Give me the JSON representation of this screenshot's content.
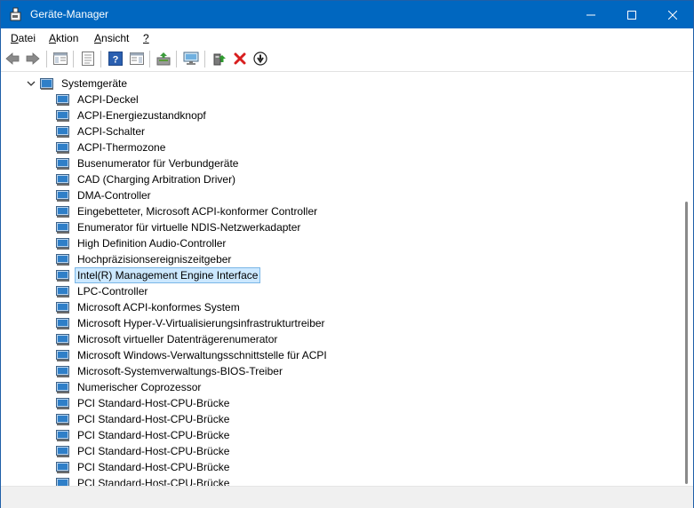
{
  "window": {
    "title": "Geräte-Manager"
  },
  "menu": {
    "items": [
      {
        "acc": "D",
        "rest": "atei"
      },
      {
        "acc": "A",
        "rest": "ktion"
      },
      {
        "acc": "A",
        "rest": "nsicht"
      },
      {
        "acc": "?",
        "rest": ""
      }
    ]
  },
  "toolbar": {
    "icons": [
      "back-icon",
      "forward-icon",
      "console-tree-icon",
      "properties-icon",
      "help-icon",
      "action-pane-icon",
      "update-driver-icon",
      "scan-hardware-icon",
      "enable-device-icon",
      "uninstall-device-icon",
      "disable-device-icon"
    ]
  },
  "tree": {
    "category": "Systemgeräte",
    "selected_index": 11,
    "devices": [
      "ACPI-Deckel",
      "ACPI-Energiezustandknopf",
      "ACPI-Schalter",
      "ACPI-Thermozone",
      "Busenumerator für Verbundgeräte",
      "CAD (Charging Arbitration Driver)",
      "DMA-Controller",
      "Eingebetteter, Microsoft ACPI-konformer Controller",
      "Enumerator für virtuelle NDIS-Netzwerkadapter",
      "High Definition Audio-Controller",
      "Hochpräzisionsereigniszeitgeber",
      "Intel(R) Management Engine Interface",
      "LPC-Controller",
      "Microsoft ACPI-konformes System",
      "Microsoft Hyper-V-Virtualisierungsinfrastrukturtreiber",
      "Microsoft virtueller Datenträgerenumerator",
      "Microsoft Windows-Verwaltungsschnittstelle für ACPI",
      "Microsoft-Systemverwaltungs-BIOS-Treiber",
      "Numerischer Coprozessor",
      "PCI Standard-Host-CPU-Brücke",
      "PCI Standard-Host-CPU-Brücke",
      "PCI Standard-Host-CPU-Brücke",
      "PCI Standard-Host-CPU-Brücke",
      "PCI Standard-Host-CPU-Brücke",
      "PCI Standard-Host-CPU-Brücke"
    ]
  },
  "colors": {
    "titlebar": "#0067c0",
    "selection": "#cce8ff",
    "selection_border": "#7ab6e6",
    "uninstall": "#d81e1e"
  }
}
